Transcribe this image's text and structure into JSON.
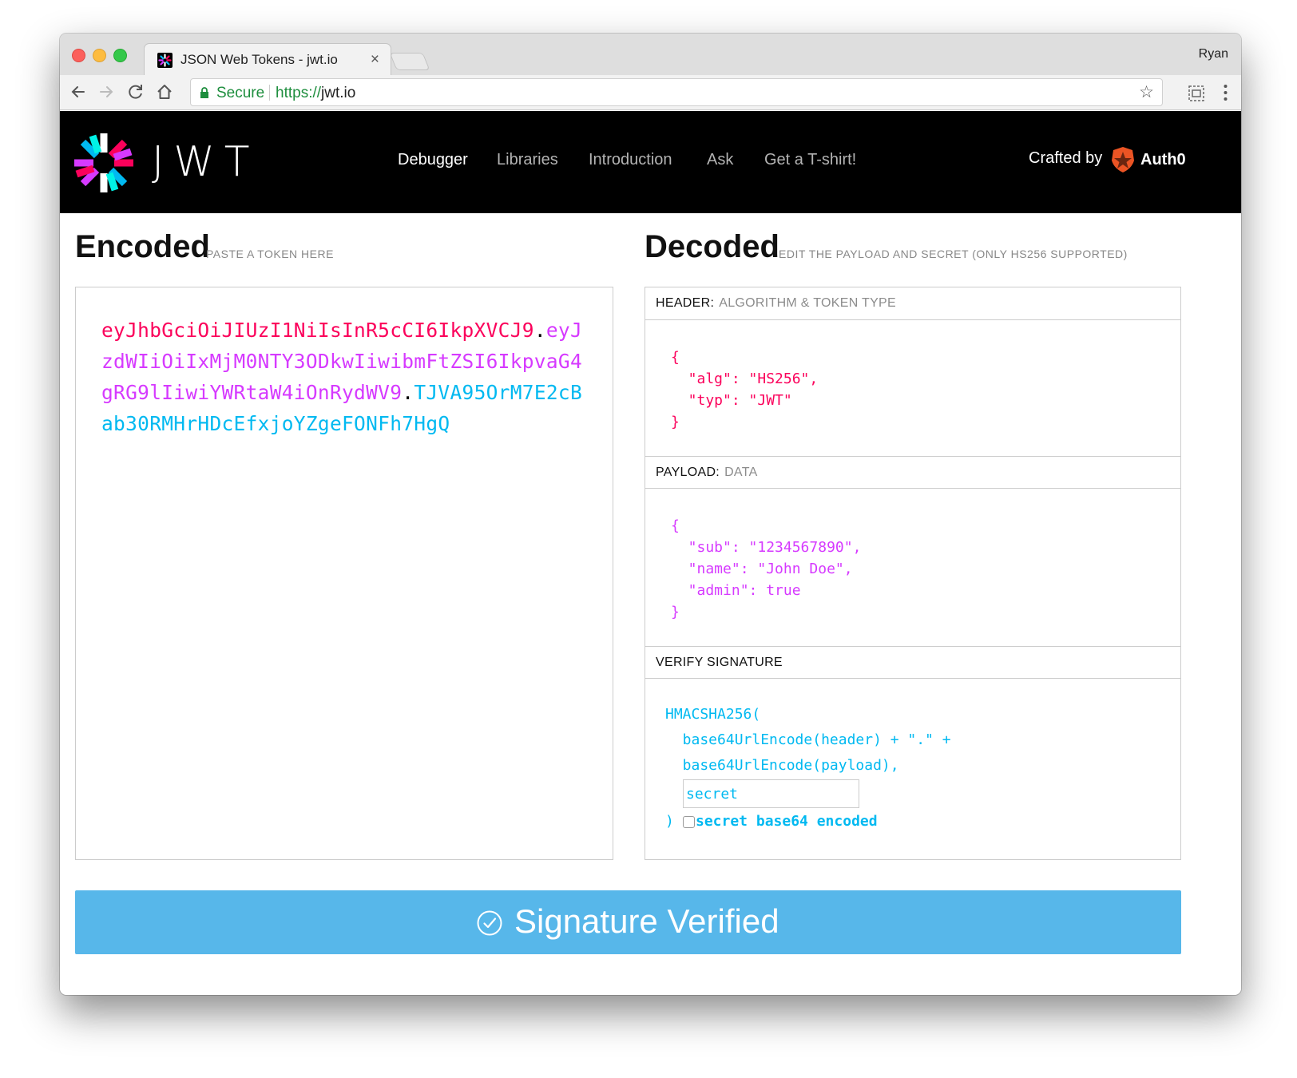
{
  "browser": {
    "tab_title": "JSON Web Tokens - jwt.io",
    "tab_close": "×",
    "profile_name": "Ryan",
    "secure_label": "Secure",
    "url_scheme": "https://",
    "url_host": "jwt.io",
    "bookmark_star": "☆"
  },
  "nav": {
    "wordmark": "JWT",
    "links": [
      "Debugger",
      "Libraries",
      "Introduction",
      "Ask",
      "Get a T-shirt!"
    ],
    "active": "Debugger",
    "crafted_by": "Crafted by",
    "brand": "Auth0"
  },
  "encoded": {
    "title": "Encoded",
    "subtitle": "PASTE A TOKEN HERE",
    "token_header": "eyJhbGciOiJIUzI1NiIsInR5cCI6IkpXVCJ9",
    "token_payload": "eyJzdWIiOiIxMjM0NTY3ODkwIiwibmFtZSI6IkpvaG4gRG9lIiwiYWRtaW4iOnRydWV9",
    "token_signature": "TJVA95OrM7E2cBab30RMHrHDcEfxjoYZgeFONFh7HgQ",
    "dot": "."
  },
  "decoded": {
    "title": "Decoded",
    "subtitle": "EDIT THE PAYLOAD AND SECRET (ONLY HS256 SUPPORTED)",
    "header_label": "HEADER:",
    "header_sub": "ALGORITHM & TOKEN TYPE",
    "header_code": "{\n  \"alg\": \"HS256\",\n  \"typ\": \"JWT\"\n}",
    "payload_label": "PAYLOAD:",
    "payload_sub": "DATA",
    "payload_code": "{\n  \"sub\": \"1234567890\",\n  \"name\": \"John Doe\",\n  \"admin\": true\n}",
    "verify_label": "VERIFY SIGNATURE",
    "verify_code": "HMACSHA256(\n  base64UrlEncode(header) + \".\" +\n  base64UrlEncode(payload),",
    "secret_value": "secret",
    "close_paren": ")",
    "base64_label": "secret base64 encoded"
  },
  "status": {
    "label": "Signature Verified"
  },
  "colors": {
    "header": "#fb015b",
    "payload": "#d63aff",
    "signature": "#00b9f1",
    "verified_bar": "#57b7ea"
  },
  "icons": [
    "back-icon",
    "forward-icon",
    "reload-icon",
    "home-icon",
    "lock-icon",
    "star-icon",
    "extension-icon",
    "menu-icon",
    "jwt-logo-icon",
    "auth0-shield-icon",
    "check-circle-icon"
  ]
}
